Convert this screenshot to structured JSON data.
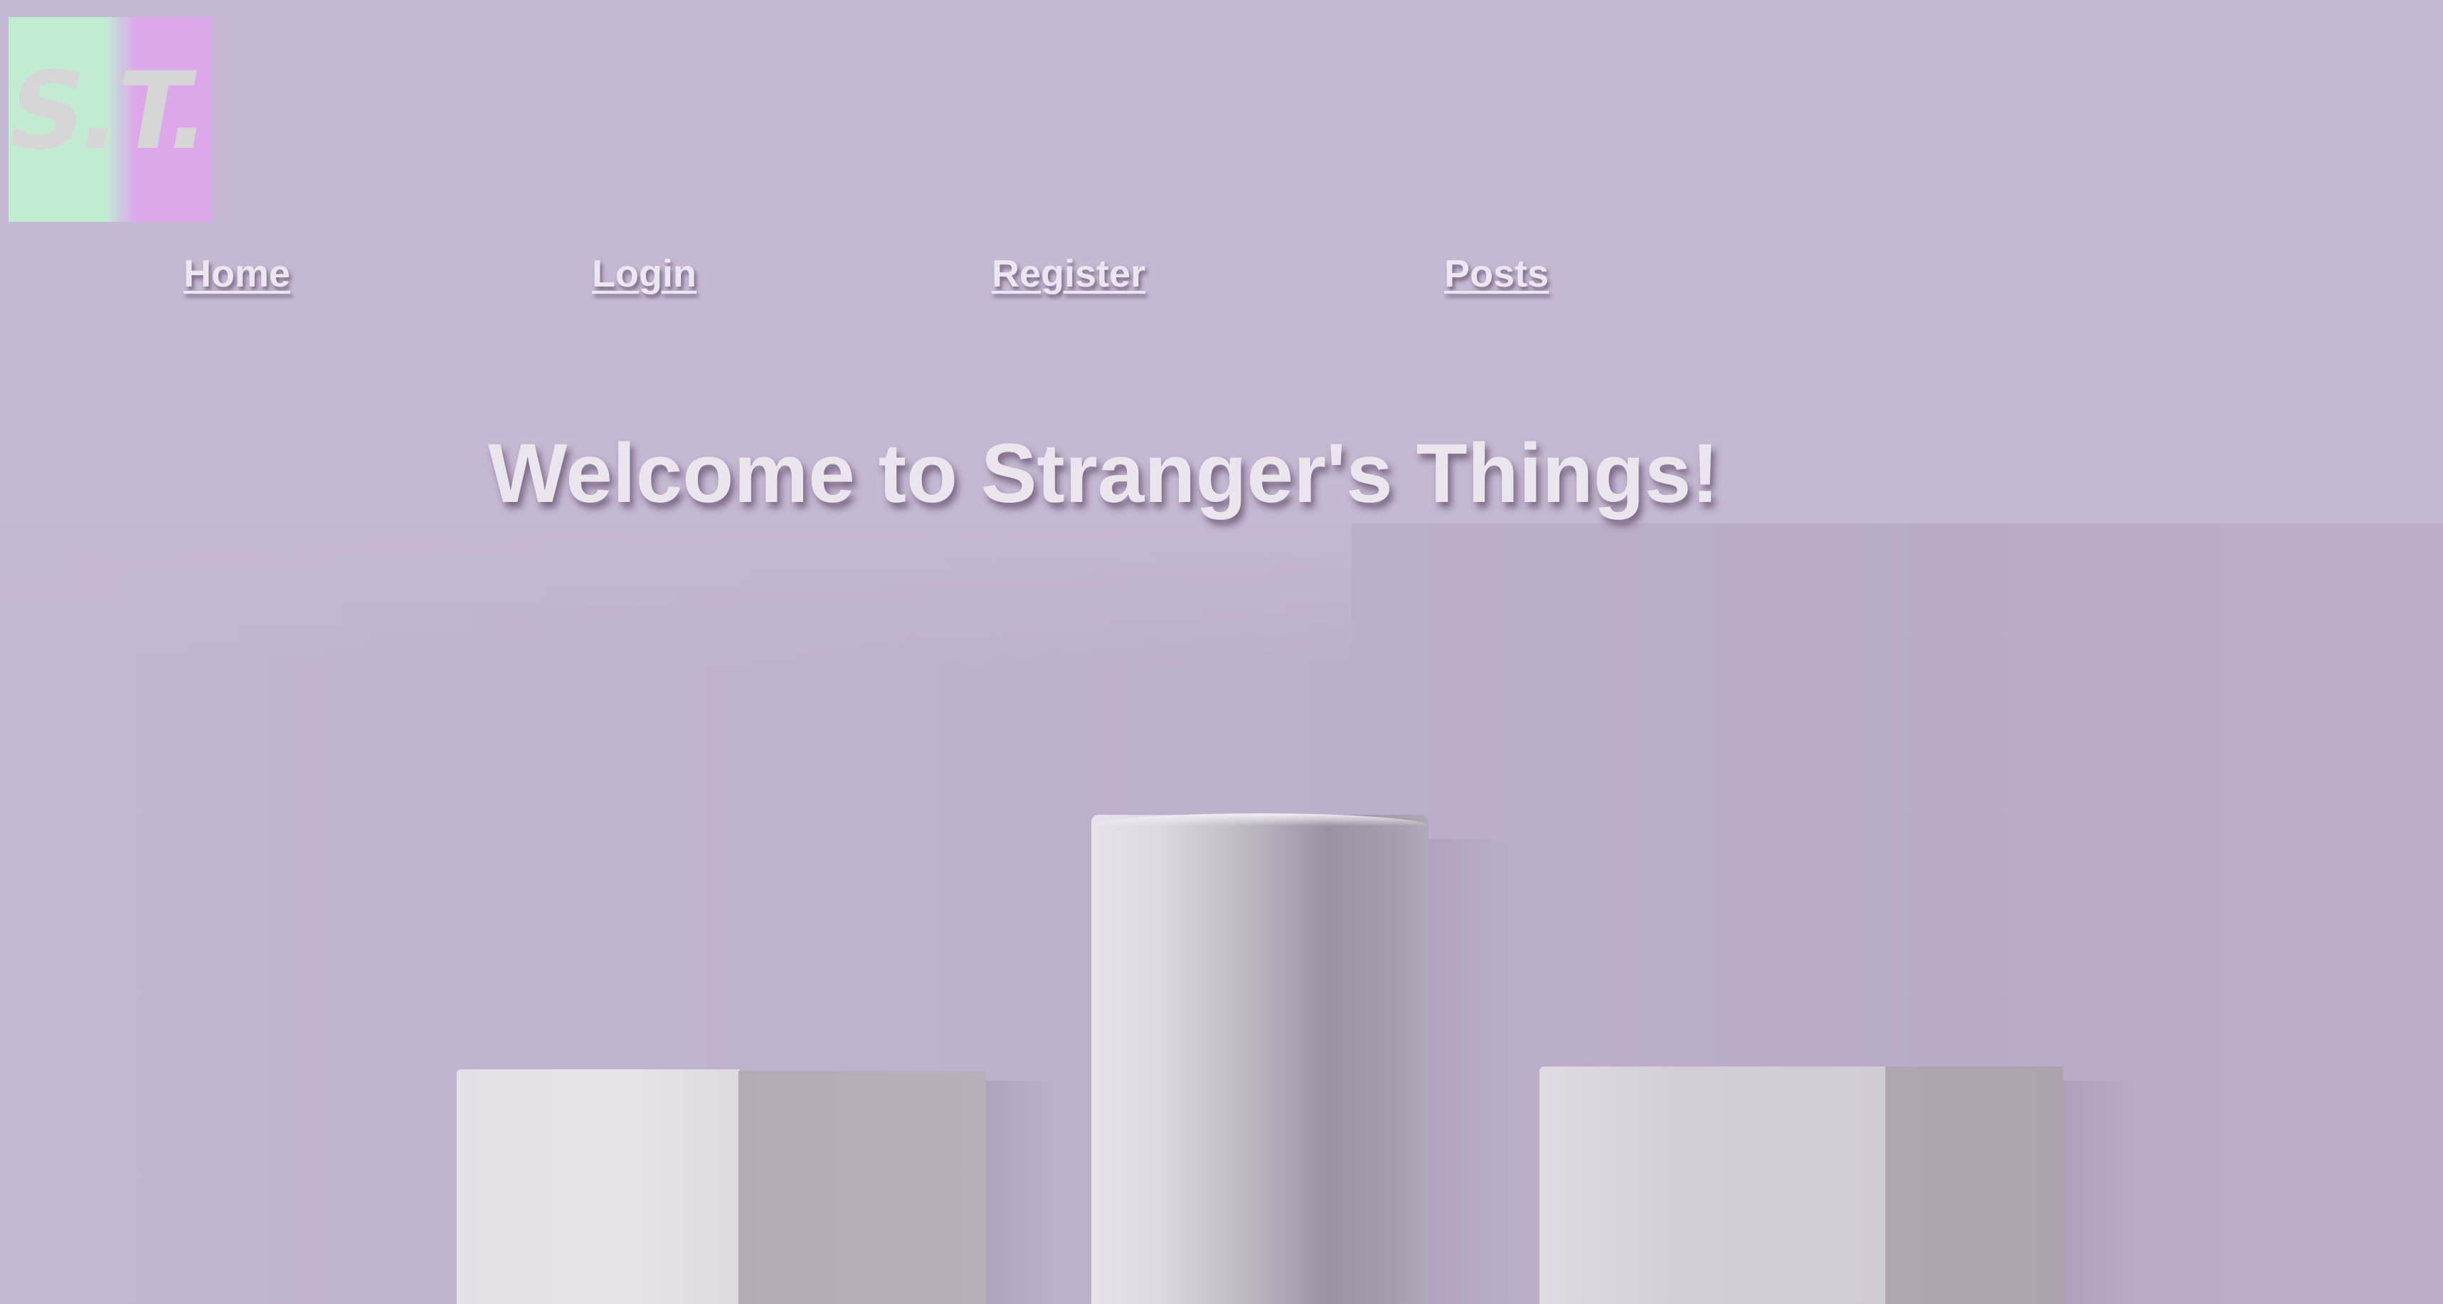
{
  "logo": {
    "text": "S.T."
  },
  "nav": {
    "home": "Home",
    "login": "Login",
    "register": "Register",
    "posts": "Posts"
  },
  "hero": {
    "heading": "Welcome to Stranger's Things!"
  },
  "colors": {
    "background": "#c5b8d2",
    "logo_left": "#c2ecd2",
    "logo_right": "#dda8ea",
    "text": "#ebe6ee"
  }
}
